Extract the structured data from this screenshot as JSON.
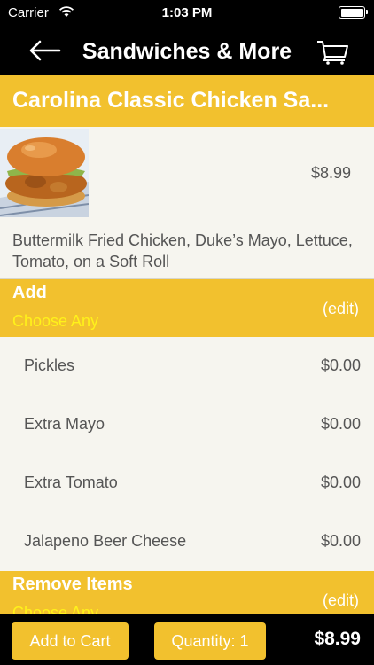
{
  "status_bar": {
    "carrier": "Carrier",
    "time": "1:03 PM"
  },
  "nav": {
    "title": "Sandwiches & More",
    "back_icon": "back-arrow-icon",
    "cart_icon": "cart-icon"
  },
  "item": {
    "name": "Carolina Classic Chicken Sa...",
    "price": "$8.99",
    "description": "Buttermilk Fried Chicken, Duke’s Mayo, Lettuce, Tomato, on a Soft Roll"
  },
  "sections": [
    {
      "title": "Add",
      "subtitle": "Choose Any",
      "edit_label": "(edit)",
      "options": [
        {
          "label": "Pickles",
          "price": "$0.00"
        },
        {
          "label": "Extra Mayo",
          "price": "$0.00"
        },
        {
          "label": "Extra Tomato",
          "price": "$0.00"
        },
        {
          "label": "Jalapeno Beer Cheese",
          "price": "$0.00"
        }
      ]
    },
    {
      "title": "Remove Items",
      "subtitle": "Choose Any",
      "edit_label": "(edit)"
    }
  ],
  "bottom_bar": {
    "add_to_cart_label": "Add to Cart",
    "quantity_label": "Quantity: 1",
    "total": "$8.99"
  },
  "colors": {
    "accent": "#f2c12e",
    "subtitle": "#fff21a",
    "background": "#f6f5ef",
    "bar": "#000000"
  }
}
